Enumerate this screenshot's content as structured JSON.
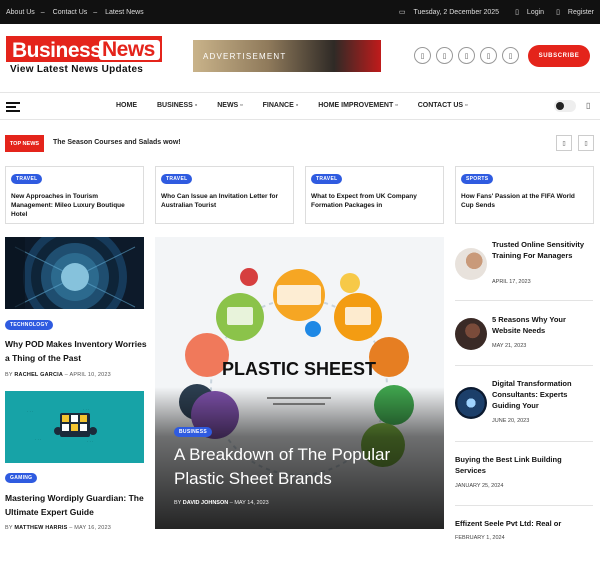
{
  "topbar": {
    "links": [
      "About Us",
      "Contact Us",
      "Latest News"
    ],
    "separator": "–",
    "date": "Tuesday, 2 December 2025",
    "login": "Login",
    "register": "Register"
  },
  "logo": {
    "word1": "Business",
    "word2": "News",
    "tagline": "View Latest News Updates"
  },
  "ad": {
    "label": "ADVERTISEMENT"
  },
  "header": {
    "subscribe": "SUBSCRIBE"
  },
  "nav": {
    "items": [
      "HOME",
      "BUSINESS ▫",
      "NEWS ▫",
      "FINANCE ▫",
      "HOME IMPROVEMENT ▫",
      "CONTACT US ▫"
    ]
  },
  "ticker": {
    "label": "TOP NEWS",
    "text": "The Season Courses and Salads wow!"
  },
  "cards": [
    {
      "tag": "TRAVEL",
      "title": "New Approaches in Tourism Management: Mileo Luxury Boutique Hotel"
    },
    {
      "tag": "TRAVEL",
      "title": "Who Can Issue an Invitation Letter for Australian Tourist"
    },
    {
      "tag": "TRAVEL",
      "title": "What to Expect from UK Company Formation Packages in"
    },
    {
      "tag": "SPORTS",
      "title": "How Fans' Passion at the FIFA World Cup Sends"
    }
  ],
  "left": [
    {
      "tag": "TECHNOLOGY",
      "title": "Why POD Makes Inventory Worries a Thing of the Past",
      "by": "BY",
      "author": "RACHEL GARCIA",
      "date": "APRIL 10, 2023"
    },
    {
      "tag": "GAMING",
      "title": "Mastering Wordiply Guardian: The Ultimate Expert Guide",
      "by": "BY",
      "author": "MATTHEW HARRIS",
      "date": "MAY 16, 2023"
    }
  ],
  "hero": {
    "tag": "BUSINESS",
    "title": "A Breakdown of The Popular Plastic Sheet Brands",
    "by": "BY",
    "author": "DAVID JOHNSON",
    "date": "MAY 14, 2023",
    "image_text": "PLASTIC SHEEST"
  },
  "right": [
    {
      "title": "Trusted Online Sensitivity Training For Managers",
      "date": "APRIL 17, 2023"
    },
    {
      "title": "5 Reasons Why Your Website Needs",
      "date": "MAY 21, 2023"
    },
    {
      "title": "Digital Transformation Consultants: Experts Guiding Your",
      "date": "JUNE 20, 2023"
    },
    {
      "title": "Buying the Best Link Building Services",
      "date": "JANUARY 25, 2024"
    },
    {
      "title": "Effizent Seele Pvt Ltd: Real or",
      "date": "FEBRUARY 1, 2024"
    }
  ],
  "colors": {
    "brand": "#e4241b",
    "badge": "#2f5be0"
  }
}
